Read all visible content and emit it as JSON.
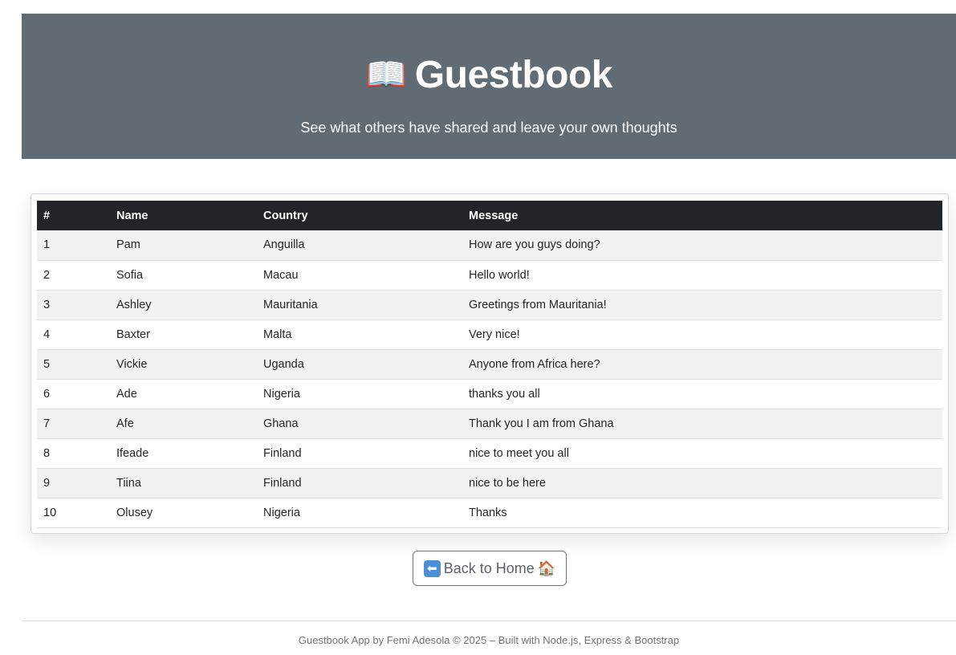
{
  "header": {
    "icon": "open-book-icon",
    "title": "Guestbook",
    "subtitle": "See what others have shared and leave your own thoughts"
  },
  "table": {
    "columns": [
      "#",
      "Name",
      "Country",
      "Message"
    ],
    "rows": [
      {
        "num": "1",
        "name": "Pam",
        "country": "Anguilla",
        "message": "How are you guys doing?"
      },
      {
        "num": "2",
        "name": "Sofia",
        "country": "Macau",
        "message": "Hello world!"
      },
      {
        "num": "3",
        "name": "Ashley",
        "country": "Mauritania",
        "message": "Greetings from Mauritania!"
      },
      {
        "num": "4",
        "name": "Baxter",
        "country": "Malta",
        "message": "Very nice!"
      },
      {
        "num": "5",
        "name": "Vickie",
        "country": "Uganda",
        "message": "Anyone from Africa here?"
      },
      {
        "num": "6",
        "name": "Ade",
        "country": "Nigeria",
        "message": "thanks you all"
      },
      {
        "num": "7",
        "name": "Afe",
        "country": "Ghana",
        "message": "Thank you I am from Ghana"
      },
      {
        "num": "8",
        "name": "Ifeade",
        "country": "Finland",
        "message": "nice to meet you all"
      },
      {
        "num": "9",
        "name": "Tiina",
        "country": "Finland",
        "message": "nice to be here"
      },
      {
        "num": "10",
        "name": "Olusey",
        "country": "Nigeria",
        "message": "Thanks"
      }
    ]
  },
  "back_button": {
    "label": "Back to Home",
    "left_icon": "left-arrow-icon",
    "right_icon": "house-icon"
  },
  "footer": {
    "text": "Guestbook App by Femi Adesola © 2025 – Built with Node.js, Express & Bootstrap"
  },
  "colors": {
    "hero_background": "#606b73",
    "table_header": "#212529",
    "striped_row": "#f2f2f2",
    "button_border": "#6c757d"
  }
}
